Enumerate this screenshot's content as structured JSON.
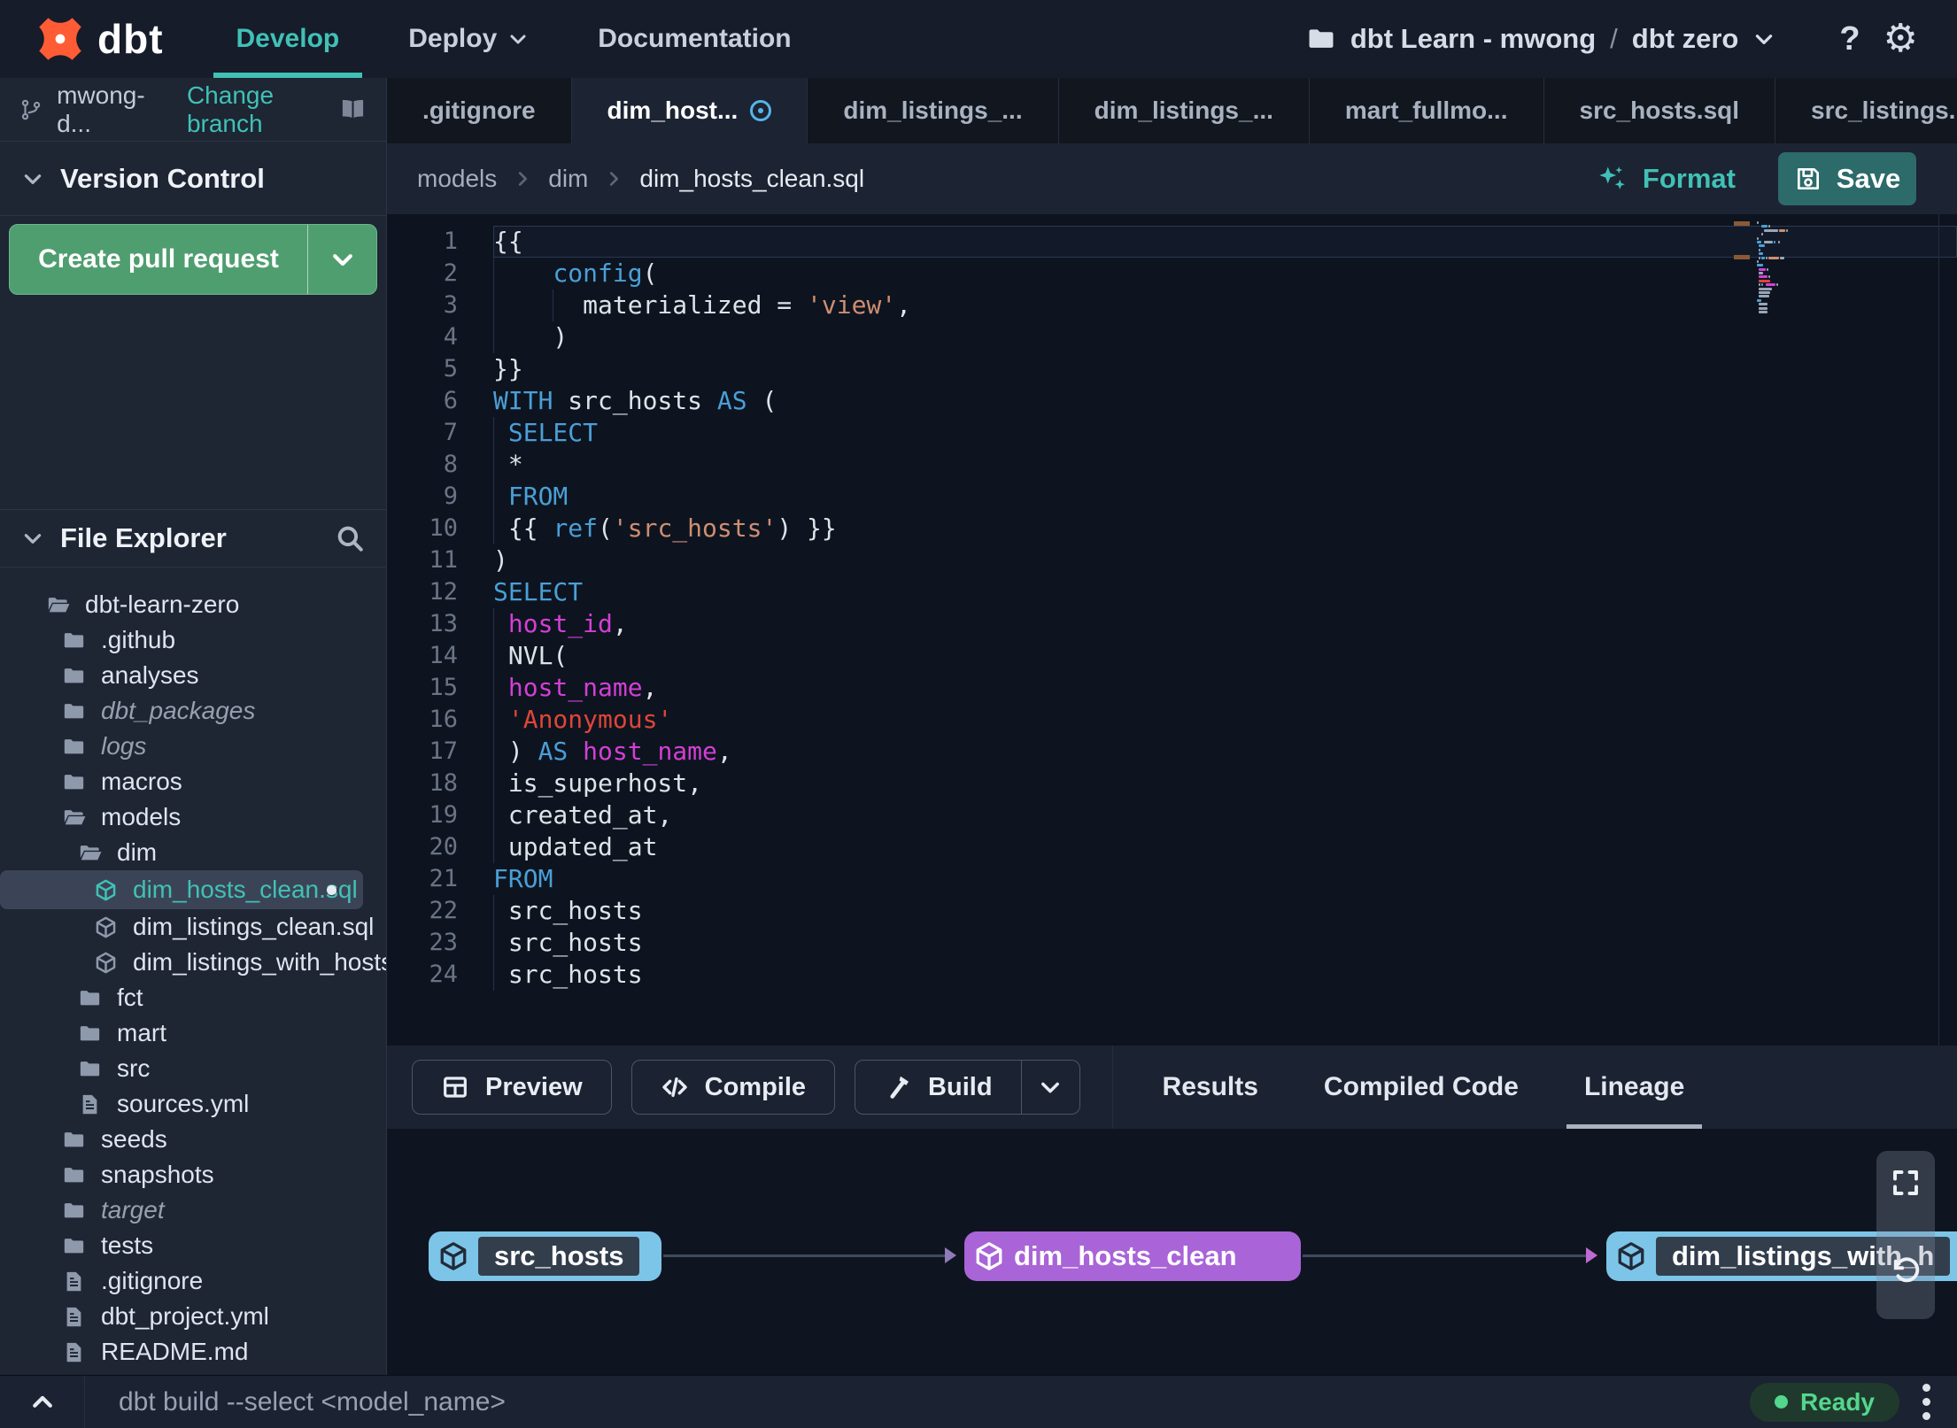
{
  "theme": {
    "accent": "#40c1b6",
    "green": "#4f9e70",
    "saveteal": "#2d6a6a",
    "kwblue": "#4b9fd6",
    "magenta": "#d43fd4",
    "red": "#df4538",
    "salmon": "#cf8e70",
    "sky": "#7cc5e8",
    "purple": "#a964d8",
    "ready": "#54d68c"
  },
  "nav": {
    "brand": "dbt",
    "menu": [
      {
        "label": "Develop",
        "active": true
      },
      {
        "label": "Deploy",
        "caret": true
      },
      {
        "label": "Documentation"
      }
    ],
    "project": {
      "account": "dbt Learn - mwong",
      "separator": "/",
      "name": "dbt zero"
    },
    "help_label": "?"
  },
  "sidebar": {
    "branch": {
      "name": "mwong-d...",
      "action": "Change branch"
    },
    "version_control": {
      "title": "Version Control",
      "create_pr": "Create pull request"
    },
    "file_explorer": {
      "title": "File Explorer"
    },
    "tree": [
      {
        "label": "dbt-learn-zero",
        "icon": "folder-open",
        "depth": 0
      },
      {
        "label": ".github",
        "icon": "folder",
        "depth": 1
      },
      {
        "label": "analyses",
        "icon": "folder",
        "depth": 1
      },
      {
        "label": "dbt_packages",
        "icon": "folder",
        "depth": 1,
        "italic": true
      },
      {
        "label": "logs",
        "icon": "folder",
        "depth": 1,
        "italic": true
      },
      {
        "label": "macros",
        "icon": "folder",
        "depth": 1
      },
      {
        "label": "models",
        "icon": "folder-open",
        "depth": 1
      },
      {
        "label": "dim",
        "icon": "folder-open",
        "depth": 2
      },
      {
        "label": "dim_hosts_clean.sql",
        "icon": "cube",
        "depth": 3,
        "selected": true,
        "modified": true
      },
      {
        "label": "dim_listings_clean.sql",
        "icon": "cube",
        "depth": 3
      },
      {
        "label": "dim_listings_with_hosts...",
        "icon": "cube",
        "depth": 3
      },
      {
        "label": "fct",
        "icon": "folder",
        "depth": 2
      },
      {
        "label": "mart",
        "icon": "folder",
        "depth": 2
      },
      {
        "label": "src",
        "icon": "folder",
        "depth": 2
      },
      {
        "label": "sources.yml",
        "icon": "doc",
        "depth": 2
      },
      {
        "label": "seeds",
        "icon": "folder",
        "depth": 1
      },
      {
        "label": "snapshots",
        "icon": "folder",
        "depth": 1
      },
      {
        "label": "target",
        "icon": "folder",
        "depth": 1,
        "italic": true
      },
      {
        "label": "tests",
        "icon": "folder",
        "depth": 1
      },
      {
        "label": ".gitignore",
        "icon": "doc",
        "depth": 1
      },
      {
        "label": "dbt_project.yml",
        "icon": "doc",
        "depth": 1
      },
      {
        "label": "README.md",
        "icon": "doc",
        "depth": 1
      }
    ]
  },
  "tabs": [
    {
      "label": ".gitignore"
    },
    {
      "label": "dim_host...",
      "active": true,
      "modified": true
    },
    {
      "label": "dim_listings_..."
    },
    {
      "label": "dim_listings_..."
    },
    {
      "label": "mart_fullmo..."
    },
    {
      "label": "src_hosts.sql"
    },
    {
      "label": "src_listings."
    }
  ],
  "editor": {
    "breadcrumb": [
      "models",
      "dim",
      "dim_hosts_clean.sql"
    ],
    "actions": {
      "format": "Format",
      "save": "Save"
    },
    "code": [
      {
        "n": 1,
        "active": true,
        "g": [],
        "t": [
          [
            "p",
            "{{"
          ]
        ]
      },
      {
        "n": 2,
        "g": [
          0
        ],
        "t": [
          [
            "p",
            "    "
          ],
          [
            "k",
            "config"
          ],
          [
            "p",
            "("
          ]
        ]
      },
      {
        "n": 3,
        "g": [
          0,
          4
        ],
        "t": [
          [
            "p",
            "      materialized = "
          ],
          [
            "s",
            "'view'"
          ],
          [
            "p",
            ","
          ]
        ]
      },
      {
        "n": 4,
        "g": [
          0
        ],
        "t": [
          [
            "p",
            "    )"
          ]
        ]
      },
      {
        "n": 5,
        "g": [],
        "t": [
          [
            "p",
            "}}"
          ]
        ]
      },
      {
        "n": 6,
        "g": [],
        "t": [
          [
            "k",
            "WITH"
          ],
          [
            "p",
            " src_hosts "
          ],
          [
            "k",
            "AS"
          ],
          [
            "p",
            " ("
          ]
        ]
      },
      {
        "n": 7,
        "g": [
          0
        ],
        "t": [
          [
            "p",
            " "
          ],
          [
            "k",
            "SELECT"
          ]
        ]
      },
      {
        "n": 8,
        "g": [
          0
        ],
        "t": [
          [
            "p",
            " *"
          ]
        ]
      },
      {
        "n": 9,
        "g": [
          0
        ],
        "t": [
          [
            "p",
            " "
          ],
          [
            "k",
            "FROM"
          ]
        ]
      },
      {
        "n": 10,
        "g": [
          0
        ],
        "t": [
          [
            "p",
            " {{ "
          ],
          [
            "k",
            "ref"
          ],
          [
            "p",
            "("
          ],
          [
            "s",
            "'src_hosts'"
          ],
          [
            "p",
            ") }}"
          ]
        ]
      },
      {
        "n": 11,
        "g": [],
        "t": [
          [
            "p",
            ")"
          ]
        ]
      },
      {
        "n": 12,
        "g": [],
        "t": [
          [
            "k",
            "SELECT"
          ]
        ]
      },
      {
        "n": 13,
        "g": [
          0
        ],
        "t": [
          [
            "p",
            " "
          ],
          [
            "m",
            "host_id"
          ],
          [
            "p",
            ","
          ]
        ]
      },
      {
        "n": 14,
        "g": [
          0
        ],
        "t": [
          [
            "p",
            " NVL("
          ]
        ]
      },
      {
        "n": 15,
        "g": [
          0
        ],
        "t": [
          [
            "p",
            " "
          ],
          [
            "m",
            "host_name"
          ],
          [
            "p",
            ","
          ]
        ]
      },
      {
        "n": 16,
        "g": [
          0
        ],
        "t": [
          [
            "p",
            " "
          ],
          [
            "r",
            "'Anonymous'"
          ]
        ]
      },
      {
        "n": 17,
        "g": [
          0
        ],
        "t": [
          [
            "p",
            " ) "
          ],
          [
            "k",
            "AS"
          ],
          [
            "p",
            " "
          ],
          [
            "m",
            "host_name"
          ],
          [
            "p",
            ","
          ]
        ]
      },
      {
        "n": 18,
        "g": [
          0
        ],
        "t": [
          [
            "p",
            " is_superhost,"
          ]
        ]
      },
      {
        "n": 19,
        "g": [
          0
        ],
        "t": [
          [
            "p",
            " created_at,"
          ]
        ]
      },
      {
        "n": 20,
        "g": [
          0
        ],
        "t": [
          [
            "p",
            " updated_at"
          ]
        ]
      },
      {
        "n": 21,
        "g": [],
        "t": [
          [
            "k",
            "FROM"
          ]
        ]
      },
      {
        "n": 22,
        "g": [
          0
        ],
        "t": [
          [
            "p",
            " src_hosts"
          ]
        ]
      },
      {
        "n": 23,
        "g": [
          0
        ],
        "t": [
          [
            "p",
            " src_hosts"
          ]
        ]
      },
      {
        "n": 24,
        "g": [
          0
        ],
        "t": [
          [
            "p",
            " src_hosts"
          ]
        ]
      }
    ]
  },
  "bottom_panel": {
    "actions": [
      {
        "label": "Preview",
        "icon": "grid"
      },
      {
        "label": "Compile",
        "icon": "code"
      },
      {
        "label": "Build",
        "icon": "hammer",
        "split": true
      }
    ],
    "tabs": [
      {
        "label": "Results"
      },
      {
        "label": "Compiled Code"
      },
      {
        "label": "Lineage",
        "active": true
      }
    ],
    "lineage": {
      "nodes": [
        {
          "label": "src_hosts",
          "style": "sky"
        },
        {
          "label": "dim_hosts_clean",
          "style": "purple"
        },
        {
          "label": "dim_listings_with_h",
          "style": "sky"
        }
      ]
    }
  },
  "command_bar": {
    "placeholder": "dbt build --select <model_name>",
    "status": "Ready"
  }
}
